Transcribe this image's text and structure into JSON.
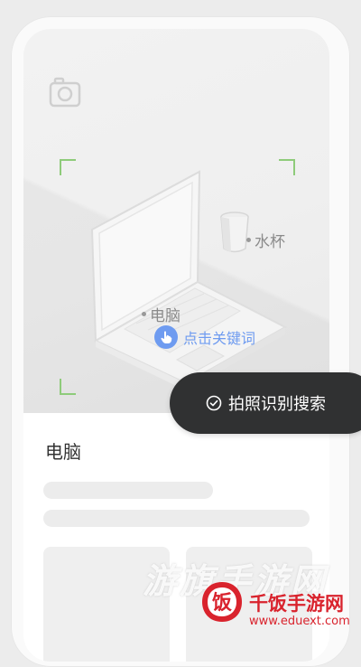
{
  "scene": {
    "tags": {
      "cup": "水杯",
      "computer": "电脑"
    },
    "hint": "点击关键词"
  },
  "search_button": {
    "label": "拍照识别搜索"
  },
  "result": {
    "title": "电脑"
  },
  "watermark": {
    "slogan": "游旗手游网",
    "site_name": "千饭手游网",
    "url": "www.eduext.com",
    "logo_char": "饭"
  },
  "colors": {
    "accent_blue": "#6e9bf0",
    "frame_green": "#8ecb7a",
    "pill_bg": "#303132",
    "watermark_red": "#d9232d"
  }
}
